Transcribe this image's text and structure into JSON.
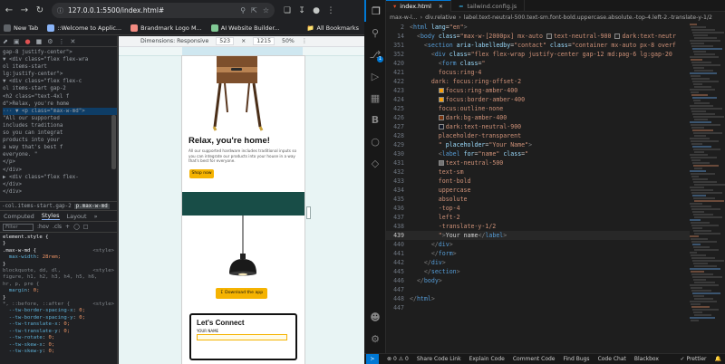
{
  "browser": {
    "url": "127.0.0.1:5500/index.html#",
    "bookmarks": [
      {
        "label": "New Tab",
        "color": "#5f6368"
      },
      {
        "label": "::Welcome to Applic...",
        "color": "#8ab4f8"
      },
      {
        "label": "Brandmark Logo M...",
        "color": "#f28b82"
      },
      {
        "label": "AI Website Builder...",
        "color": "#81c995"
      }
    ],
    "all_bookmarks": "All Bookmarks"
  },
  "devtools": {
    "dom_lines": [
      {
        "text": "gap-8 justify-center\">",
        "sel": false
      },
      {
        "text": "▼ <div class=\"flex flex-wra",
        "sel": false
      },
      {
        "text": "   ol items-start",
        "sel": false
      },
      {
        "text": "   lg:justify-center\">",
        "sel": false
      },
      {
        "text": " ▼ <div class=\"flex flex-c",
        "sel": false
      },
      {
        "text": "   ol items-start gap-2",
        "sel": false
      },
      {
        "text": "   <h2 class=\"text-4xl f",
        "sel": false
      },
      {
        "text": "   d\">Relax, you're home",
        "sel": false
      },
      {
        "text": "··· ▼ <p class=\"max-w-md\">",
        "sel": true
      },
      {
        "text": "      \"All our supported",
        "sel": false
      },
      {
        "text": "      includes traditiona",
        "sel": false
      },
      {
        "text": "      so you can integrat",
        "sel": false
      },
      {
        "text": "      products into your",
        "sel": false
      },
      {
        "text": "      a way that's best f",
        "sel": false
      },
      {
        "text": "      everyone. \"",
        "sel": false
      },
      {
        "text": "     </p>",
        "sel": false
      },
      {
        "text": "   </div>",
        "sel": false
      },
      {
        "text": "   ▶ <div class=\"flex flex-",
        "sel": false
      },
      {
        "text": "      </div>",
        "sel": false
      },
      {
        "text": "   </div>",
        "sel": false
      }
    ],
    "crumb_prev": "-col.items-start.gap-2",
    "crumb_active": "p.max-w-md",
    "style_tabs": [
      "Computed",
      "Styles",
      "Layout"
    ],
    "more_tabs": "»",
    "filter_placeholder": "Filter",
    "filter_tools": [
      ":hov",
      ".cls",
      "+"
    ],
    "css_rules": [
      {
        "selector": "element.style {",
        "source": ""
      },
      {
        "selector": "}",
        "source": ""
      },
      {
        "selector": ".max-w-md {",
        "source": "<style>"
      },
      {
        "prop": "max-width",
        "value": "28rem;"
      },
      {
        "selector": "}",
        "source": ""
      },
      {
        "selector": "blockquote, dd, dl,",
        "source": "<style>",
        "muted": true
      },
      {
        "selector": "figure, h1, h2, h3, h4, h5, h6,",
        "muted": true
      },
      {
        "selector": "hr, p, pre {",
        "muted": true
      },
      {
        "prop": "margin",
        "value": "0;"
      },
      {
        "selector": "}",
        "source": ""
      },
      {
        "selector": "*, ::before, ::after {",
        "source": "<style>",
        "muted": true
      },
      {
        "prop": "--tw-border-spacing-x",
        "value": "0;"
      },
      {
        "prop": "--tw-border-spacing-y",
        "value": "0;"
      },
      {
        "prop": "--tw-translate-x",
        "value": "0;"
      },
      {
        "prop": "--tw-translate-y",
        "value": "0;"
      },
      {
        "prop": "--tw-rotate",
        "value": "0;"
      },
      {
        "prop": "--tw-skew-x",
        "value": "0;"
      },
      {
        "prop": "--tw-skew-y",
        "value": "0;"
      }
    ]
  },
  "viewport": {
    "dimensions_label": "Dimensions: Responsive",
    "width": "523",
    "height": "1215",
    "zoom": "50%",
    "page": {
      "heading": "Relax, you're home!",
      "paragraph": "All our supported hardware includes traditional inputs so you can integrate our products into your house in a way that's best for everyone.",
      "shop_button": "Shop now",
      "download_button": "Download the app",
      "connect_heading": "Let's Connect",
      "name_label": "YOUR NAME"
    }
  },
  "vscode": {
    "tabs": [
      {
        "label": "index.html",
        "active": true,
        "icon": "html-icon"
      },
      {
        "label": "tailwind.config.js",
        "active": false,
        "icon": "tailwind-icon"
      }
    ],
    "breadcrumbs": [
      "max-w-l...",
      "div.relative",
      "label.text-neutral-500.text-sm.font-bold.uppercase.absolute.-top-4.left-2.-translate-y-1/2"
    ],
    "lines": [
      {
        "n": "2",
        "html": "<span class='t'>&lt;</span><span class='tn'>html</span> <span class='an'>lang</span>=<span class='sv'>\"en\"</span><span class='t'>&gt;</span>"
      },
      {
        "n": "14",
        "html": "  <span class='t'>&lt;</span><span class='tn'>body</span> <span class='an'>class</span>=<span class='sv'>\"max-w-[2000px] mx-auto <span class='sw' style='background:#262626'></span>text-neutral-900 <span class='sw' style='background:#262626'></span>dark:text-neutr</span>"
      },
      {
        "n": "351",
        "html": "    <span class='t'>&lt;</span><span class='tn'>section</span> <span class='an'>aria-labelledby</span>=<span class='sv'>\"contact\"</span> <span class='an'>class</span>=<span class='sv'>\"container mx-auto px-8 overf</span>"
      },
      {
        "n": "352",
        "html": "      <span class='t'>&lt;</span><span class='tn'>div</span> <span class='an'>class</span>=<span class='sv'>\"flex flex-wrap justify-center gap-12 md:pag-6 lg:gap-20</span>"
      },
      {
        "n": "420",
        "html": "        <span class='t'>&lt;</span><span class='tn'>form</span> <span class='an'>class</span>=<span class='sv'>\"</span>"
      },
      {
        "n": "421",
        "html": "        <span class='sv'>focus:ring-4</span>"
      },
      {
        "n": "422",
        "html": "      <span class='sv'>dark: focus:ring-offset-2</span>"
      },
      {
        "n": "423",
        "html": "        <span class='sv'><span class='sw' style='background:#f59e0b'></span>focus:ring-amber-400</span>"
      },
      {
        "n": "424",
        "html": "        <span class='sv'><span class='sw' style='background:#f59e0b'></span>focus:border-amber-400</span>"
      },
      {
        "n": "425",
        "html": "        <span class='sv'>focus:outline-none</span>"
      },
      {
        "n": "426",
        "html": "        <span class='sv'><span class='sw' style='background:#78350f'></span>dark:bg-amber-400</span>"
      },
      {
        "n": "427",
        "html": "        <span class='sv'><span class='sw' style='background:#111827'></span>dark:text-neutral-900</span>"
      },
      {
        "n": "428",
        "html": "        <span class='sv'>placeholder-transparent</span>"
      },
      {
        "n": "429",
        "html": "        <span class='sv'>\"</span> <span class='an'>placeholder</span>=<span class='sv'>\"Your Name\"</span><span class='t'>&gt;</span>"
      },
      {
        "n": "430",
        "html": "        <span class='t'>&lt;</span><span class='tn'>label</span> <span class='an'>for</span>=<span class='sv'>\"name\"</span> <span class='an'>class</span>=<span class='sv'>\"</span>"
      },
      {
        "n": "431",
        "html": "        <span class='sv'><span class='sw' style='background:#737373'></span>text-neutral-500</span>"
      },
      {
        "n": "432",
        "html": "        <span class='sv'>text-sm</span>"
      },
      {
        "n": "433",
        "html": "        <span class='sv'>font-bold</span>"
      },
      {
        "n": "434",
        "html": "        <span class='sv'>uppercase</span>"
      },
      {
        "n": "435",
        "html": "        <span class='sv'>absolute</span>"
      },
      {
        "n": "436",
        "html": "        <span class='sv'>-top-4</span>"
      },
      {
        "n": "437",
        "html": "        <span class='sv'>left-2</span>"
      },
      {
        "n": "438",
        "html": "        <span class='sv'>-translate-y-1/2</span>"
      },
      {
        "n": "439",
        "html": "        <span class='sv'>\"</span><span class='t'>&gt;</span><span class='tx'>Your name</span><span class='t'>&lt;/</span><span class='tn'>label</span><span class='t'>&gt;</span>",
        "cur": true
      },
      {
        "n": "440",
        "html": "      <span class='t'>&lt;/</span><span class='tn'>div</span><span class='t'>&gt;</span>"
      },
      {
        "n": "441",
        "html": "      <span class='t'>&lt;/</span><span class='tn'>form</span><span class='t'>&gt;</span>"
      },
      {
        "n": "442",
        "html": "    <span class='t'>&lt;/</span><span class='tn'>div</span><span class='t'>&gt;</span>"
      },
      {
        "n": "445",
        "html": "    <span class='t'>&lt;/</span><span class='tn'>section</span><span class='t'>&gt;</span>"
      },
      {
        "n": "446",
        "html": "  <span class='t'>&lt;/</span><span class='tn'>body</span><span class='t'>&gt;</span>"
      },
      {
        "n": "447",
        "html": ""
      },
      {
        "n": "448",
        "html": "<span class='t'>&lt;/</span><span class='tn'>html</span><span class='t'>&gt;</span>"
      },
      {
        "n": "447",
        "html": ""
      }
    ],
    "status": {
      "errors": "0",
      "warnings": "0",
      "items": [
        "Share Code Link",
        "Explain Code",
        "Comment Code",
        "Find Bugs",
        "Code Chat",
        "Blackbox"
      ],
      "prettier": "Prettier"
    }
  }
}
